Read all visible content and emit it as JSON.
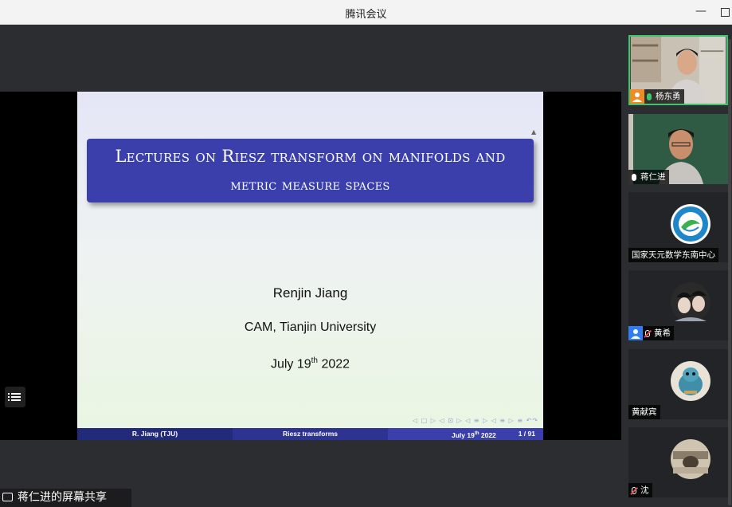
{
  "window": {
    "title": "腾讯会议"
  },
  "slide": {
    "title_line1": "Lectures on Riesz transform on manifolds and",
    "title_line2": "metric measure spaces",
    "author": "Renjin Jiang",
    "affiliation": "CAM, Tianjin University",
    "date_prefix": "July 19",
    "date_sup": "th",
    "date_suffix": " 2022",
    "footer_author": "R. Jiang  (TJU)",
    "footer_title": "Riesz transforms",
    "footer_date_prefix": "July 19",
    "footer_date_sup": "th",
    "footer_date_suffix": " 2022",
    "footer_page": "1 / 91"
  },
  "share": {
    "label": "蒋仁进的屏幕共享"
  },
  "participants": [
    {
      "name": "杨东勇",
      "mic": "on",
      "host": true,
      "video": true
    },
    {
      "name": "蒋仁进",
      "mic": "on",
      "host": false,
      "video": true
    },
    {
      "name": "国家天元数学东南中心",
      "mic": "none",
      "host": false,
      "video": false
    },
    {
      "name": "黄希",
      "mic": "off",
      "host": true,
      "video": false
    },
    {
      "name": "黄献宾",
      "mic": "none",
      "host": false,
      "video": false
    },
    {
      "name": "沈",
      "mic": "off",
      "host": false,
      "video": false
    }
  ],
  "colors": {
    "active_border": "#3ec46d",
    "slide_title_bg": "#3b3fab",
    "host_badge": "#f08a24"
  }
}
